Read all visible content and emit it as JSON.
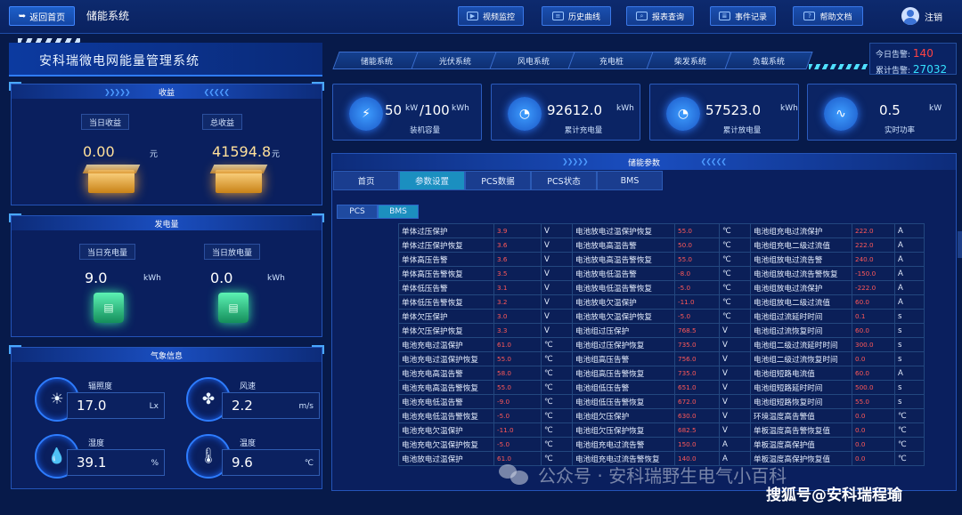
{
  "topbar": {
    "back_label": "返回首页",
    "app_title": "储能系统",
    "buttons": [
      {
        "label": "视频监控",
        "icon": "video-icon"
      },
      {
        "label": "历史曲线",
        "icon": "chart-icon"
      },
      {
        "label": "报表查询",
        "icon": "search-icon"
      },
      {
        "label": "事件记录",
        "icon": "event-icon"
      },
      {
        "label": "帮助文档",
        "icon": "help-icon"
      }
    ],
    "logout_label": "注销"
  },
  "header": {
    "system_title": "安科瑞微电网能量管理系统",
    "tabs": [
      "储能系统",
      "光伏系统",
      "风电系统",
      "充电桩",
      "柴发系统",
      "负载系统"
    ],
    "alarm_today_label": "今日告警:",
    "alarm_today_value": "140",
    "alarm_total_label": "累计告警:",
    "alarm_total_value": "27032"
  },
  "income": {
    "title": "收益",
    "today_label": "当日收益",
    "today_value": "0.00",
    "today_unit": "元",
    "total_label": "总收益",
    "total_value": "41594.8",
    "total_unit": "元"
  },
  "energy": {
    "title": "发电量",
    "charge_label": "当日充电量",
    "charge_value": "9.0",
    "charge_unit": "kWh",
    "discharge_label": "当日放电量",
    "discharge_value": "0.0",
    "discharge_unit": "kWh"
  },
  "weather": {
    "title": "气象信息",
    "irradiance_label": "辐照度",
    "irradiance_value": "17.0",
    "irradiance_unit": "Lx",
    "wind_label": "风速",
    "wind_value": "2.2",
    "wind_unit": "m/s",
    "humidity_label": "湿度",
    "humidity_value": "39.1",
    "humidity_unit": "%",
    "temp_label": "温度",
    "temp_value": "9.6",
    "temp_unit": "℃"
  },
  "stats": [
    {
      "value": "50",
      "unit1": "kW",
      "value2": "/100",
      "unit2": "kWh",
      "caption": "装机容量"
    },
    {
      "value": "92612.0",
      "unit": "kWh",
      "caption": "累计充电量"
    },
    {
      "value": "57523.0",
      "unit": "kWh",
      "caption": "累计放电量"
    },
    {
      "value": "0.5",
      "unit": "kW",
      "caption": "实时功率"
    }
  ],
  "params": {
    "title": "储能参数",
    "main_tabs": [
      "首页",
      "参数设置",
      "PCS数据",
      "PCS状态",
      "BMS"
    ],
    "active_main_tab": "参数设置",
    "sub_tabs": [
      "PCS",
      "BMS"
    ],
    "active_sub_tab": "BMS",
    "rows": [
      [
        "单体过压保护",
        "3.9",
        "V",
        "电池放电过温保护恢复",
        "55.0",
        "℃",
        "电池组充电过流保护",
        "222.0",
        "A"
      ],
      [
        "单体过压保护恢复",
        "3.6",
        "V",
        "电池放电高温告警",
        "50.0",
        "℃",
        "电池组充电二级过流值",
        "222.0",
        "A"
      ],
      [
        "单体高压告警",
        "3.6",
        "V",
        "电池放电高温告警恢复",
        "55.0",
        "℃",
        "电池组放电过流告警",
        "240.0",
        "A"
      ],
      [
        "单体高压告警恢复",
        "3.5",
        "V",
        "电池放电低温告警",
        "-8.0",
        "℃",
        "电池组放电过流告警恢复",
        "-150.0",
        "A"
      ],
      [
        "单体低压告警",
        "3.1",
        "V",
        "电池放电低温告警恢复",
        "-5.0",
        "℃",
        "电池组放电过流保护",
        "-222.0",
        "A"
      ],
      [
        "单体低压告警恢复",
        "3.2",
        "V",
        "电池放电欠温保护",
        "-11.0",
        "℃",
        "电池组放电二级过流值",
        "60.0",
        "A"
      ],
      [
        "单体欠压保护",
        "3.0",
        "V",
        "电池放电欠温保护恢复",
        "-5.0",
        "℃",
        "电池组过流延时时间",
        "0.1",
        "s"
      ],
      [
        "单体欠压保护恢复",
        "3.3",
        "V",
        "电池组过压保护",
        "768.5",
        "V",
        "电池组过流恢复时间",
        "60.0",
        "s"
      ],
      [
        "电池充电过温保护",
        "61.0",
        "℃",
        "电池组过压保护恢复",
        "735.0",
        "V",
        "电池组二级过流延时时间",
        "300.0",
        "s"
      ],
      [
        "电池充电过温保护恢复",
        "55.0",
        "℃",
        "电池组高压告警",
        "756.0",
        "V",
        "电池组二级过流恢复时间",
        "0.0",
        "s"
      ],
      [
        "电池充电高温告警",
        "58.0",
        "℃",
        "电池组高压告警恢复",
        "735.0",
        "V",
        "电池组短路电流值",
        "60.0",
        "A"
      ],
      [
        "电池充电高温告警恢复",
        "55.0",
        "℃",
        "电池组低压告警",
        "651.0",
        "V",
        "电池组短路延时时间",
        "500.0",
        "s"
      ],
      [
        "电池充电低温告警",
        "-9.0",
        "℃",
        "电池组低压告警恢复",
        "672.0",
        "V",
        "电池组短路恢复时间",
        "55.0",
        "s"
      ],
      [
        "电池充电低温告警恢复",
        "-5.0",
        "℃",
        "电池组欠压保护",
        "630.0",
        "V",
        "环境温度高告警值",
        "0.0",
        "℃"
      ],
      [
        "电池充电欠温保护",
        "-11.0",
        "℃",
        "电池组欠压保护恢复",
        "682.5",
        "V",
        "单板温度高告警恢复值",
        "0.0",
        "℃"
      ],
      [
        "电池充电欠温保护恢复",
        "-5.0",
        "℃",
        "电池组充电过流告警",
        "150.0",
        "A",
        "单板温度高保护值",
        "0.0",
        "℃"
      ],
      [
        "电池放电过温保护",
        "61.0",
        "℃",
        "电池组充电过流告警恢复",
        "140.0",
        "A",
        "单板温度高保护恢复值",
        "0.0",
        "℃"
      ]
    ]
  },
  "watermarks": {
    "wechat": "公众号 · 安科瑞野生电气小百科",
    "sohu": "搜狐号@安科瑞程瑜"
  }
}
